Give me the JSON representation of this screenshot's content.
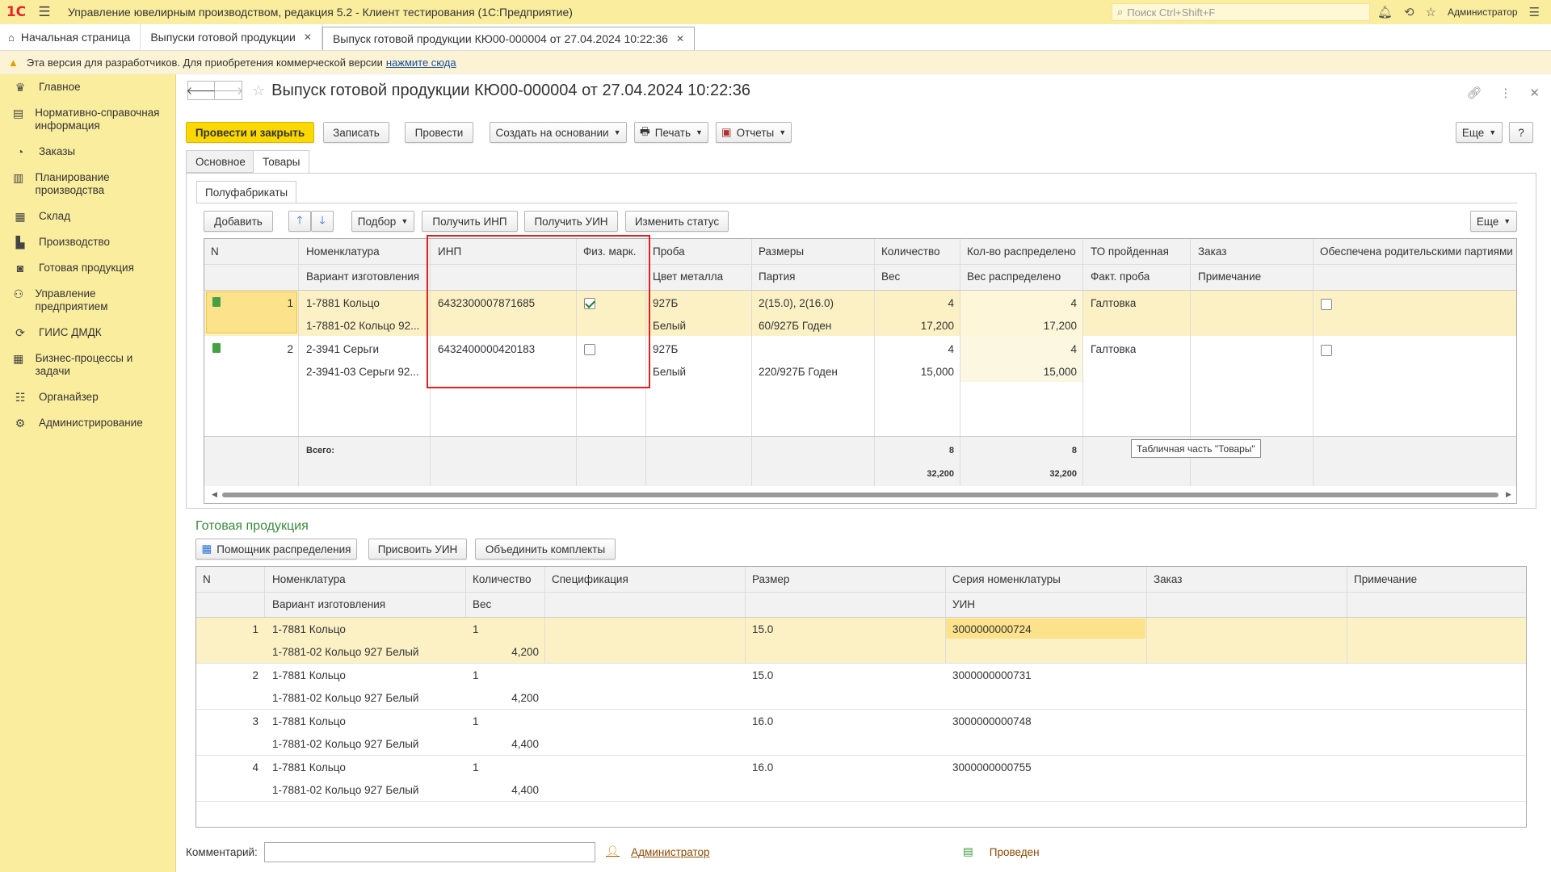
{
  "app": {
    "logo": "1С",
    "title": "Управление ювелирным производством, редакция 5.2 - Клиент тестирования (1С:Предприятие)",
    "search_placeholder": "Поиск Ctrl+Shift+F",
    "user": "Администратор"
  },
  "tabs": [
    {
      "label": "Начальная страница"
    },
    {
      "label": "Выпуски готовой продукции"
    },
    {
      "label": "Выпуск готовой продукции КЮ00-000004 от 27.04.2024 10:22:36"
    }
  ],
  "devbar": {
    "text": "Эта версия для разработчиков. Для приобретения коммерческой версии",
    "link": "нажмите сюда"
  },
  "sidebar": {
    "items": [
      {
        "label": "Главное",
        "icon": "crown-icon"
      },
      {
        "label": "Нормативно-справочная информация",
        "icon": "book-icon"
      },
      {
        "label": "Заказы",
        "icon": "pie-icon"
      },
      {
        "label": "Планирование производства",
        "icon": "clipboard-icon"
      },
      {
        "label": "Склад",
        "icon": "grid-icon"
      },
      {
        "label": "Производство",
        "icon": "factory-icon"
      },
      {
        "label": "Готовая продукция",
        "icon": "bag-icon"
      },
      {
        "label": "Управление предприятием",
        "icon": "org-icon"
      },
      {
        "label": "ГИИС ДМДК",
        "icon": "sync-icon"
      },
      {
        "label": "Бизнес-процессы и задачи",
        "icon": "building-icon"
      },
      {
        "label": "Органайзер",
        "icon": "list-icon"
      },
      {
        "label": "Администрирование",
        "icon": "gear-icon"
      }
    ]
  },
  "doc": {
    "title": "Выпуск готовой продукции КЮ00-000004 от 27.04.2024 10:22:36",
    "toolbar": {
      "post_close": "Провести и закрыть",
      "save": "Записать",
      "post": "Провести",
      "create_based": "Создать на основании",
      "print": "Печать",
      "reports": "Отчеты",
      "more": "Еще",
      "help": "?"
    },
    "form_tabs": [
      "Основное",
      "Товары"
    ],
    "subtab": "Полуфабрикаты",
    "table_toolbar": {
      "add": "Добавить",
      "pick": "Подбор",
      "get_inp": "Получить ИНП",
      "get_uin": "Получить УИН",
      "change_status": "Изменить статус",
      "more": "Еще"
    },
    "semi_table": {
      "headers1": [
        "N",
        "Номенклатура",
        "ИНП",
        "Физ. марк.",
        "Проба",
        "Размеры",
        "Количество",
        "Кол-во распределено",
        "ТО пройденная",
        "Заказ",
        "Обеспечена родительскими партиями"
      ],
      "headers2": [
        "",
        "Вариант изготовления",
        "",
        "",
        "Цвет металла",
        "Партия",
        "Вес",
        "Вес распределено",
        "Факт. проба",
        "Примечание",
        ""
      ],
      "rows": [
        {
          "n": "1",
          "nom": "1-7881 Кольцо",
          "variant": "1-7881-02 Кольцо 92...",
          "inp": "6432300007871685",
          "phys": true,
          "proba": "927Б",
          "color": "Белый",
          "sizes": "2(15.0), 2(16.0)",
          "batch": "60/927Б Годен",
          "qty": "4",
          "weight": "17,200",
          "dist_qty": "4",
          "dist_weight": "17,200",
          "to": "Галтовка",
          "fact": "",
          "order": "",
          "note": "",
          "provided": false
        },
        {
          "n": "2",
          "nom": "2-3941 Серьги",
          "variant": "2-3941-03 Серьги 92...",
          "inp": "6432400000420183",
          "phys": false,
          "proba": "927Б",
          "color": "Белый",
          "sizes": "",
          "batch": "220/927Б Годен",
          "qty": "4",
          "weight": "15,000",
          "dist_qty": "4",
          "dist_weight": "15,000",
          "to": "Галтовка",
          "fact": "",
          "order": "",
          "note": "",
          "provided": false
        }
      ],
      "totals": {
        "label": "Всего:",
        "qty": "8",
        "weight": "32,200",
        "dist_qty": "8",
        "dist_weight": "32,200"
      },
      "tooltip": "Табличная часть \"Товары\""
    },
    "finished": {
      "title": "Готовая продукция",
      "toolbar": {
        "assistant": "Помощник распределения",
        "assign_uin": "Присвоить УИН",
        "merge": "Объединить комплекты"
      },
      "headers1": [
        "N",
        "Номенклатура",
        "Количество",
        "Спецификация",
        "Размер",
        "Серия номенклатуры",
        "Заказ",
        "Примечание"
      ],
      "headers2": [
        "",
        "Вариант изготовления",
        "Вес",
        "",
        "",
        "УИН",
        "",
        ""
      ],
      "rows": [
        {
          "n": "1",
          "nom": "1-7881 Кольцо",
          "variant": "1-7881-02 Кольцо 927 Белый",
          "qty": "1",
          "weight": "4,200",
          "size": "15.0",
          "uin": "3000000000724"
        },
        {
          "n": "2",
          "nom": "1-7881 Кольцо",
          "variant": "1-7881-02 Кольцо 927 Белый",
          "qty": "1",
          "weight": "4,200",
          "size": "15.0",
          "uin": "3000000000731"
        },
        {
          "n": "3",
          "nom": "1-7881 Кольцо",
          "variant": "1-7881-02 Кольцо 927 Белый",
          "qty": "1",
          "weight": "4,400",
          "size": "16.0",
          "uin": "3000000000748"
        },
        {
          "n": "4",
          "nom": "1-7881 Кольцо",
          "variant": "1-7881-02 Кольцо 927 Белый",
          "qty": "1",
          "weight": "4,400",
          "size": "16.0",
          "uin": "3000000000755"
        }
      ]
    },
    "footer": {
      "comment_label": "Комментарий:",
      "comment_value": "",
      "author": "Администратор",
      "status": "Проведен"
    }
  }
}
